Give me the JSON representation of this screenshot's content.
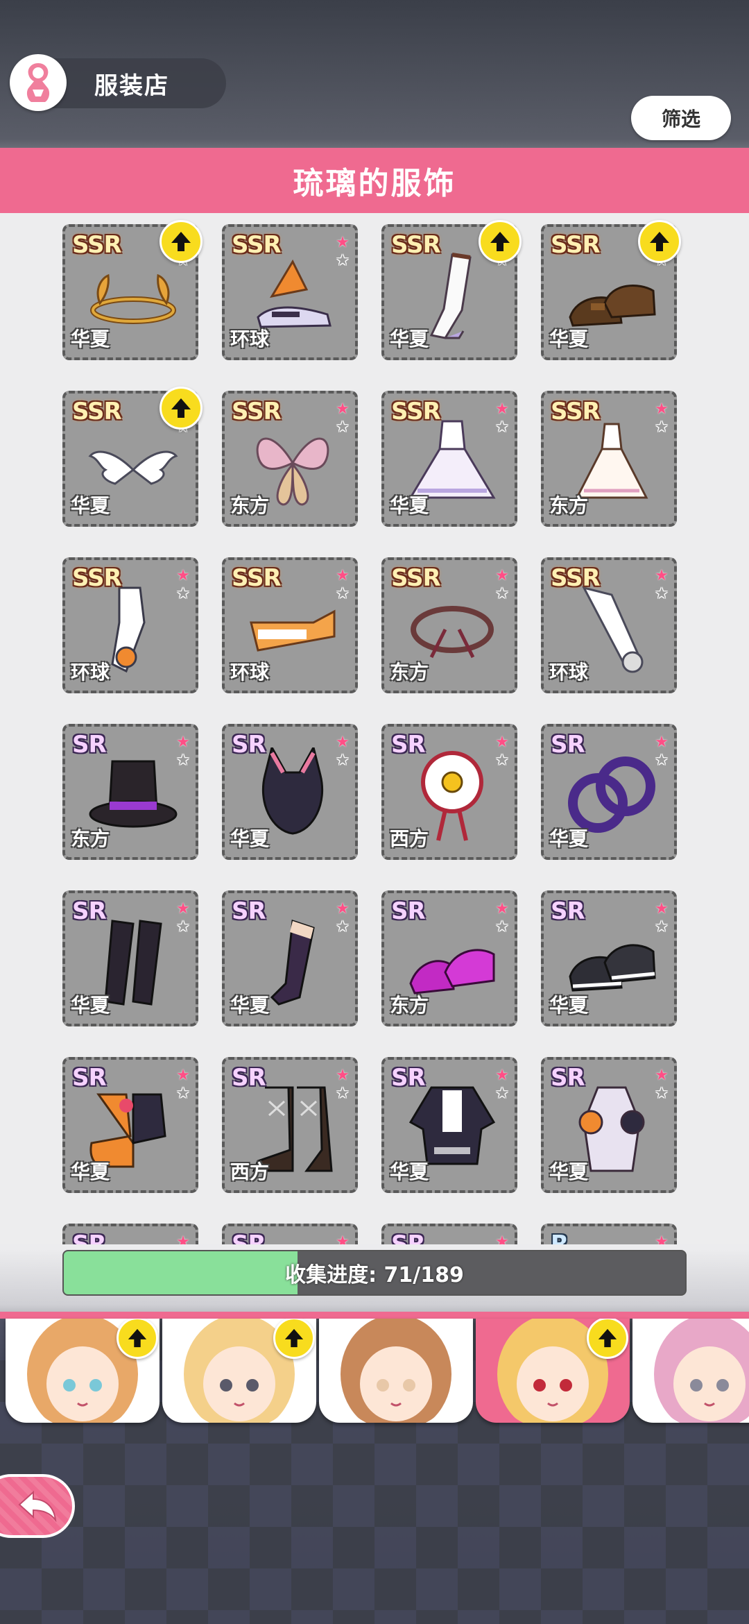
{
  "header": {
    "shop_title": "服装店",
    "filter_label": "筛选",
    "banner_title": "琉璃的服饰"
  },
  "colors": {
    "accent_pink": "#ef6a90",
    "upgrade_yellow": "#f8dc1e",
    "progress_green": "#89e09a"
  },
  "items": [
    {
      "rarity": "SSR",
      "region": "华夏",
      "upgrade": true,
      "icon": "laurel-crown-icon"
    },
    {
      "rarity": "SSR",
      "region": "环球",
      "upgrade": false,
      "icon": "winged-shoe-icon"
    },
    {
      "rarity": "SSR",
      "region": "华夏",
      "upgrade": true,
      "icon": "white-stockings-icon"
    },
    {
      "rarity": "SSR",
      "region": "华夏",
      "upgrade": true,
      "icon": "brown-loafers-icon"
    },
    {
      "rarity": "SSR",
      "region": "华夏",
      "upgrade": true,
      "icon": "angel-wings-icon"
    },
    {
      "rarity": "SSR",
      "region": "东方",
      "upgrade": false,
      "icon": "fairy-wings-icon"
    },
    {
      "rarity": "SSR",
      "region": "华夏",
      "upgrade": false,
      "icon": "white-ball-gown-icon"
    },
    {
      "rarity": "SSR",
      "region": "东方",
      "upgrade": false,
      "icon": "white-dress-icon"
    },
    {
      "rarity": "SSR",
      "region": "环球",
      "upgrade": false,
      "icon": "outfit-figure-icon"
    },
    {
      "rarity": "SSR",
      "region": "环球",
      "upgrade": false,
      "icon": "orange-visor-icon"
    },
    {
      "rarity": "SSR",
      "region": "东方",
      "upgrade": false,
      "icon": "rope-choker-icon"
    },
    {
      "rarity": "SSR",
      "region": "环球",
      "upgrade": false,
      "icon": "white-sleeve-icon"
    },
    {
      "rarity": "SR",
      "region": "东方",
      "upgrade": false,
      "icon": "top-hat-icon"
    },
    {
      "rarity": "SR",
      "region": "华夏",
      "upgrade": false,
      "icon": "cat-ear-hood-icon"
    },
    {
      "rarity": "SR",
      "region": "西方",
      "upgrade": false,
      "icon": "rosette-bell-icon"
    },
    {
      "rarity": "SR",
      "region": "华夏",
      "upgrade": false,
      "icon": "purple-rings-icon"
    },
    {
      "rarity": "SR",
      "region": "华夏",
      "upgrade": false,
      "icon": "black-stockings-icon"
    },
    {
      "rarity": "SR",
      "region": "华夏",
      "upgrade": false,
      "icon": "thigh-high-socks-icon"
    },
    {
      "rarity": "SR",
      "region": "东方",
      "upgrade": false,
      "icon": "magenta-heels-icon"
    },
    {
      "rarity": "SR",
      "region": "华夏",
      "upgrade": false,
      "icon": "black-sneakers-icon"
    },
    {
      "rarity": "SR",
      "region": "华夏",
      "upgrade": false,
      "icon": "pumpkin-boots-icon"
    },
    {
      "rarity": "SR",
      "region": "西方",
      "upgrade": false,
      "icon": "lace-up-boots-icon"
    },
    {
      "rarity": "SR",
      "region": "华夏",
      "upgrade": false,
      "icon": "black-jacket-icon"
    },
    {
      "rarity": "SR",
      "region": "华夏",
      "upgrade": false,
      "icon": "mech-suit-icon"
    },
    {
      "rarity": "SR",
      "region": "",
      "upgrade": false,
      "icon": "partial-item-icon"
    },
    {
      "rarity": "SR",
      "region": "",
      "upgrade": false,
      "icon": "partial-item-icon"
    },
    {
      "rarity": "SR",
      "region": "",
      "upgrade": false,
      "icon": "partial-item-icon"
    },
    {
      "rarity": "R",
      "region": "",
      "upgrade": false,
      "icon": "partial-item-icon"
    }
  ],
  "progress": {
    "label": "收集进度: 71/189",
    "collected": 71,
    "total": 189
  },
  "characters": [
    {
      "icon": "character-blonde-fox-girl-icon",
      "upgrade": true,
      "selected": false
    },
    {
      "icon": "character-cap-girl-icon",
      "upgrade": true,
      "selected": false
    },
    {
      "icon": "character-cat-ear-girl-icon",
      "upgrade": false,
      "selected": false
    },
    {
      "icon": "character-liuli-icon",
      "upgrade": true,
      "selected": true
    },
    {
      "icon": "character-pink-hair-girl-icon",
      "upgrade": false,
      "selected": false
    }
  ],
  "back": {
    "icon": "back-arrow-icon"
  }
}
